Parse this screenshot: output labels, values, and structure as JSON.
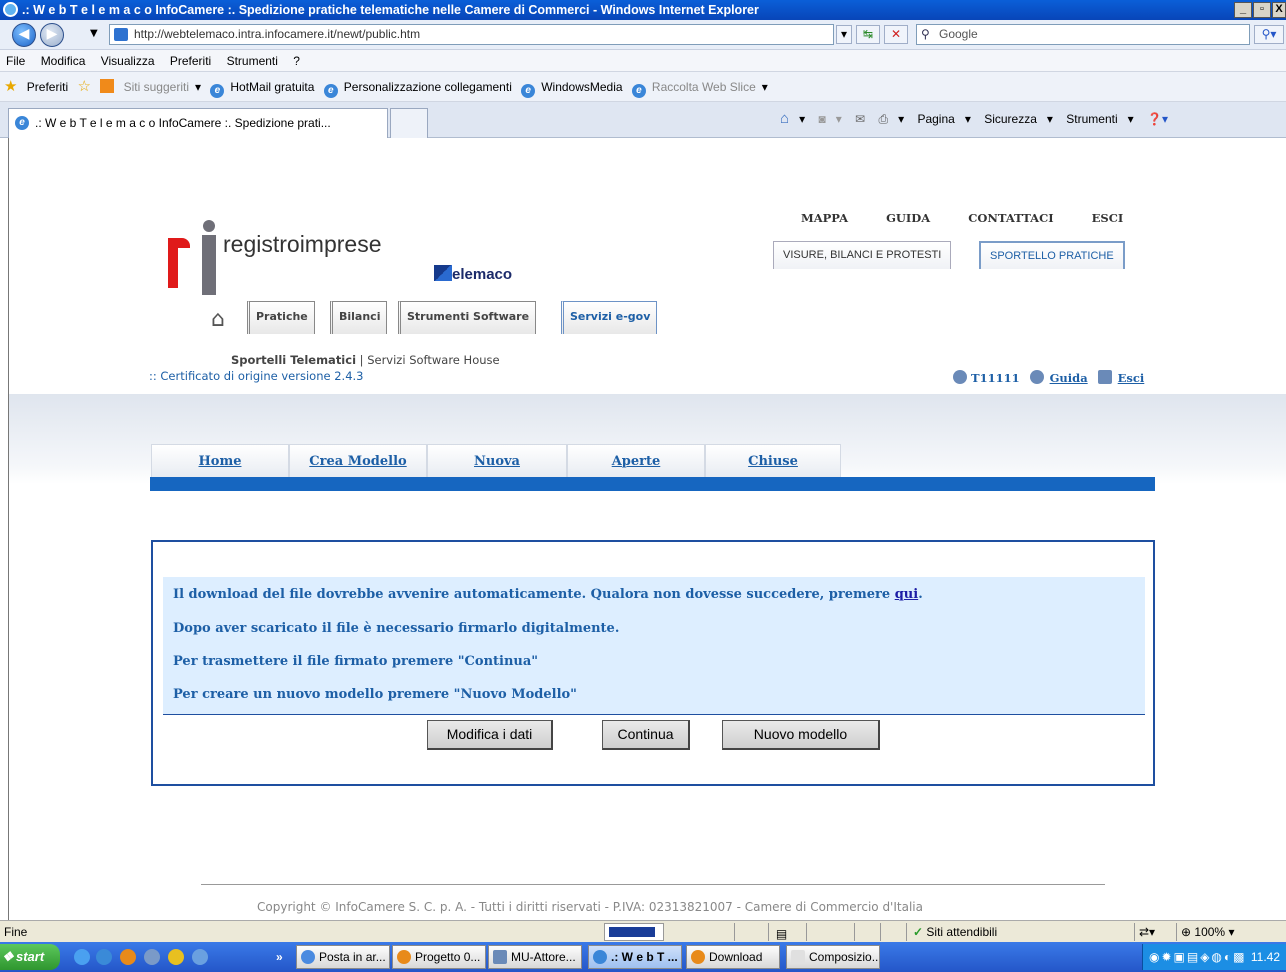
{
  "window": {
    "title": ".: W e b T e l e m a c o InfoCamere :. Spedizione pratiche telematiche nelle Camere di Commerci - Windows Internet Explorer",
    "controls": [
      "_",
      "̸",
      "X"
    ]
  },
  "browser": {
    "address": "http://webtelemaco.intra.infocamere.it/newt/public.htm",
    "search_placeholder": "Google",
    "menu": [
      "File",
      "Modifica",
      "Visualizza",
      "Preferiti",
      "Strumenti",
      "?"
    ],
    "favorites": {
      "label": "Preferiti",
      "items": [
        "Siti suggeriti",
        "HotMail gratuita",
        "Personalizzazione collegamenti",
        "WindowsMedia",
        "Raccolta Web Slice"
      ]
    },
    "tab_title": ".: W e b T e l e m a c o InfoCamere :. Spedizione prati...",
    "commands": [
      "Pagina",
      "Sicurezza",
      "Strumenti"
    ]
  },
  "site": {
    "top_links": [
      "MAPPA",
      "GUIDA",
      "CONTATTACI",
      "ESCI"
    ],
    "top_buttons": [
      "VISURE, BILANCI E PROTESTI",
      "SPORTELLO PRATICHE"
    ],
    "logo_text": "registroimprese",
    "telemaco_text": "elemaco",
    "main_tabs": [
      "Pratiche",
      "Bilanci",
      "Strumenti Software",
      "Servizi e-gov"
    ],
    "sportelli_bold": "Sportelli Telematici",
    "sportelli_rest": " | Servizi Software House",
    "certificato": ":: Certificato di origine versione 2.4.3",
    "user": "T11111",
    "guida": "Guida",
    "esci": "Esci"
  },
  "nav_tabs": [
    "Home",
    "Crea Modello",
    "Nuova",
    "Aperte",
    "Chiuse"
  ],
  "messages": {
    "line1_prefix": "Il download del file dovrebbe avvenire automaticamente. Qualora non dovesse succedere, premere ",
    "line1_link": "qui",
    "line1_suffix": ".",
    "line2": "Dopo aver scaricato il file è necessario firmarlo digitalmente.",
    "line3": "Per trasmettere il file firmato premere \"Continua\"",
    "line4": "Per creare un nuovo modello premere \"Nuovo Modello\""
  },
  "buttons": {
    "modifica": "Modifica i dati",
    "continua": "Continua",
    "nuovo": "Nuovo modello"
  },
  "footer": {
    "copyright": "Copyright © InfoCamere S. C. p. A. - Tutti i diritti riservati - P.IVA: 02313821007 - Camere di Commercio d'Italia"
  },
  "statusbar": {
    "text": "Fine",
    "zone": "Siti attendibili",
    "zoom": "100%"
  },
  "taskbar": {
    "start": "start",
    "items": [
      "Posta in ar...",
      "Progetto 0...",
      "MU-Attore...",
      ".: W e b T ...",
      "Download",
      "Composizio..."
    ],
    "clock": "11.42"
  }
}
